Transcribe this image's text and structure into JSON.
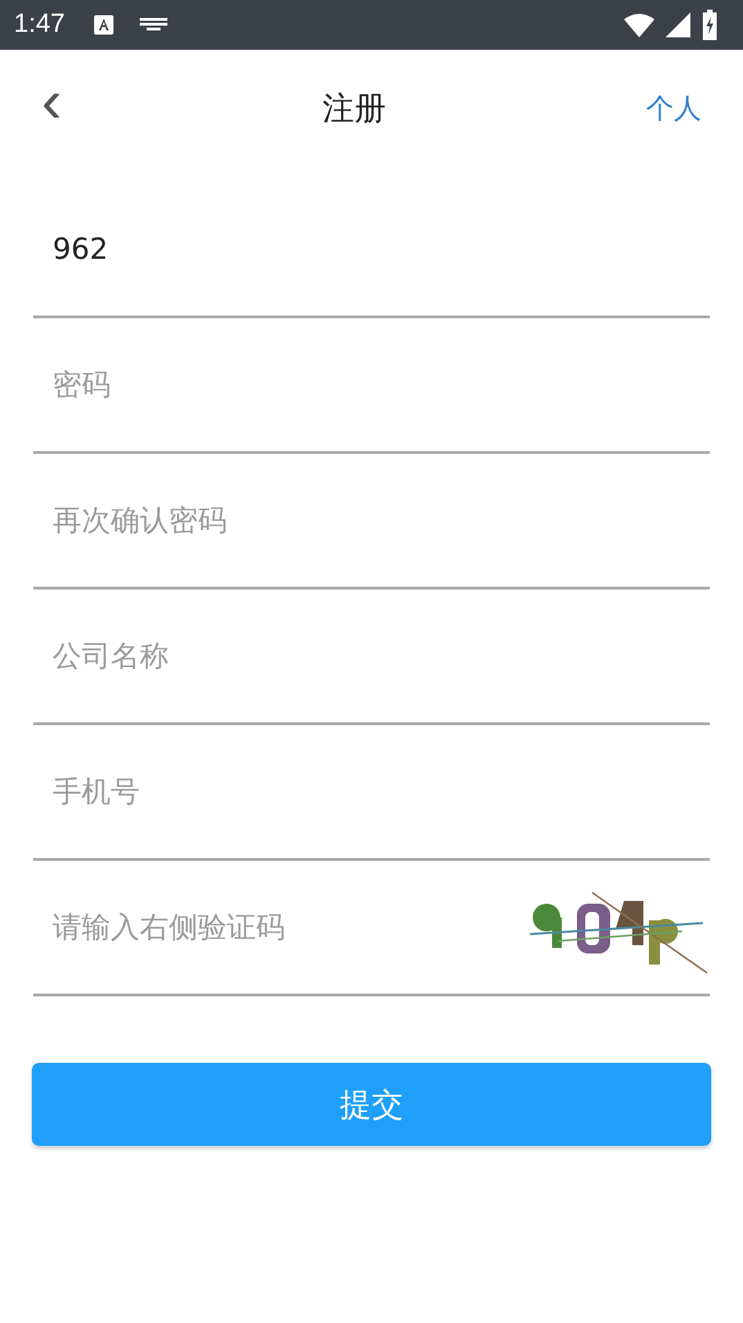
{
  "status_bar": {
    "time": "1:47"
  },
  "header": {
    "back": "‹",
    "title": "注册",
    "action": "个人"
  },
  "fields": [
    {
      "kind": "text",
      "value": "962"
    },
    {
      "kind": "text",
      "placeholder": "密码"
    },
    {
      "kind": "text",
      "placeholder": "再次确认密码"
    },
    {
      "kind": "text",
      "placeholder": "公司名称"
    },
    {
      "kind": "text",
      "placeholder": "手机号"
    },
    {
      "kind": "captcha",
      "placeholder": "请输入右侧验证码"
    }
  ],
  "submit": "提交"
}
